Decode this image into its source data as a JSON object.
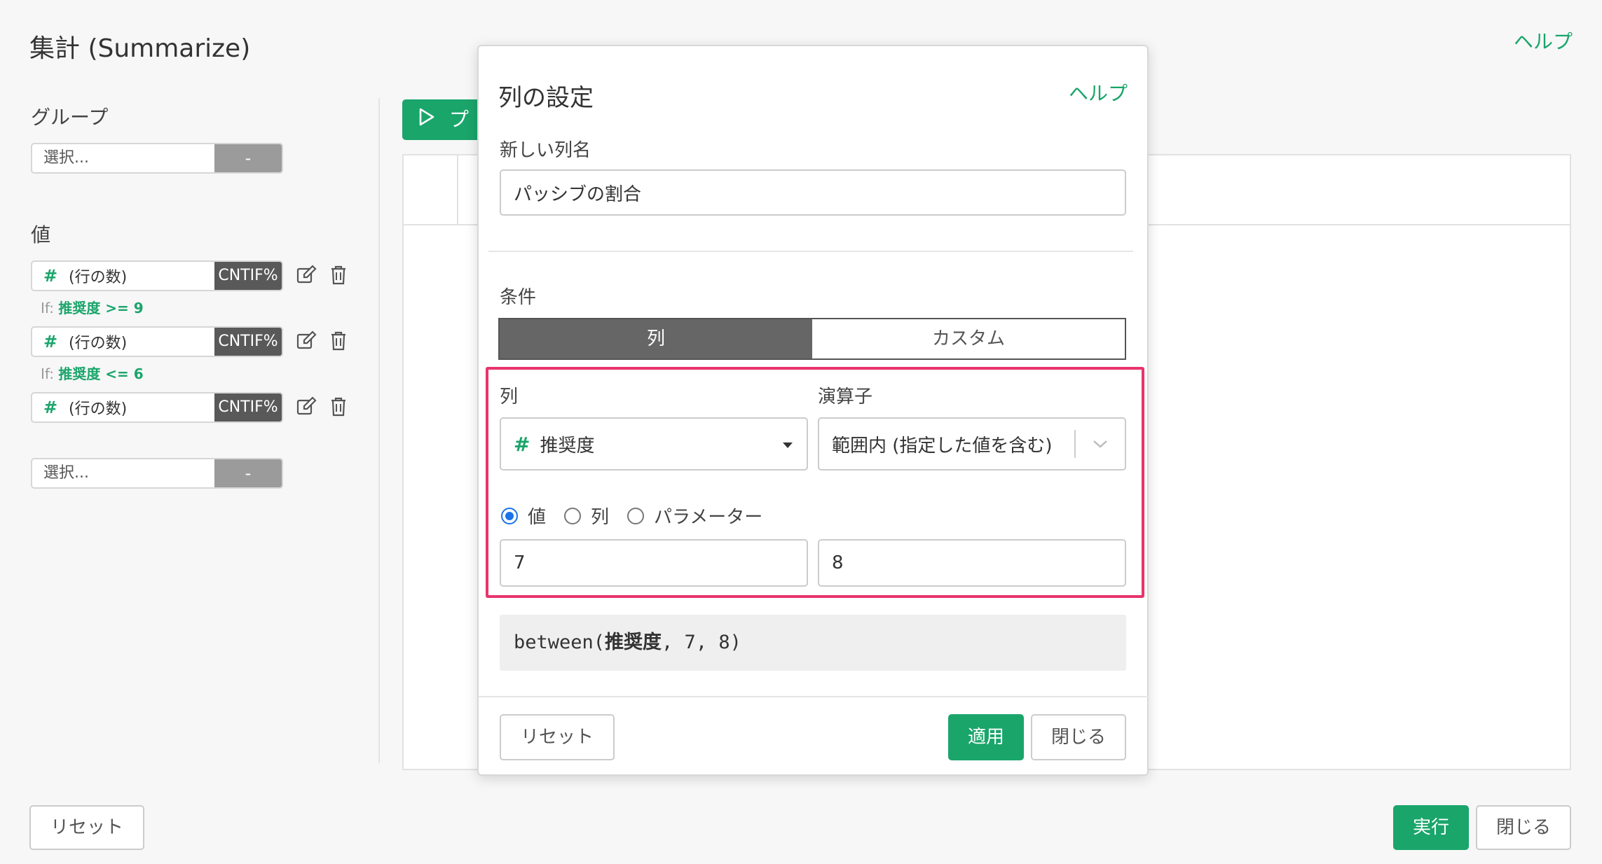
{
  "page": {
    "title": "集計 (Summarize)",
    "help": "ヘルプ"
  },
  "left": {
    "group_label": "グループ",
    "group_select": {
      "placeholder": "選択...",
      "dash": "-"
    },
    "value_label": "値",
    "values": [
      {
        "hash": "#",
        "name": "(行の数)",
        "agg": "CNTIF%",
        "cond_prefix": "If:",
        "cond_expr": "推奨度 >= 9"
      },
      {
        "hash": "#",
        "name": "(行の数)",
        "agg": "CNTIF%",
        "cond_prefix": "If:",
        "cond_expr": "推奨度 <= 6"
      },
      {
        "hash": "#",
        "name": "(行の数)",
        "agg": "CNTIF%"
      }
    ],
    "value_select": {
      "placeholder": "選択...",
      "dash": "-"
    }
  },
  "preview_button_partial": "プ",
  "footer": {
    "reset": "リセット",
    "run": "実行",
    "close": "閉じる"
  },
  "modal": {
    "title": "列の設定",
    "help": "ヘルプ",
    "new_col_label": "新しい列名",
    "new_col_value": "パッシブの割合",
    "condition_label": "条件",
    "tabs": {
      "column": "列",
      "custom": "カスタム"
    },
    "col_label": "列",
    "col_select": {
      "hash": "#",
      "value": "推奨度"
    },
    "op_label": "演算子",
    "op_select": "範囲内 (指定した値を含む)",
    "radios": {
      "value": "値",
      "column": "列",
      "parameter": "パラメーター",
      "selected": "value"
    },
    "value1": "7",
    "value2": "8",
    "expr": {
      "pre": "between(",
      "col": "推奨度",
      "post": ", 7, 8)"
    },
    "buttons": {
      "reset": "リセット",
      "apply": "適用",
      "close": "閉じる"
    }
  },
  "colors": {
    "accent": "#1aa56b",
    "highlight": "#e8336d",
    "radio": "#1a73e8"
  }
}
